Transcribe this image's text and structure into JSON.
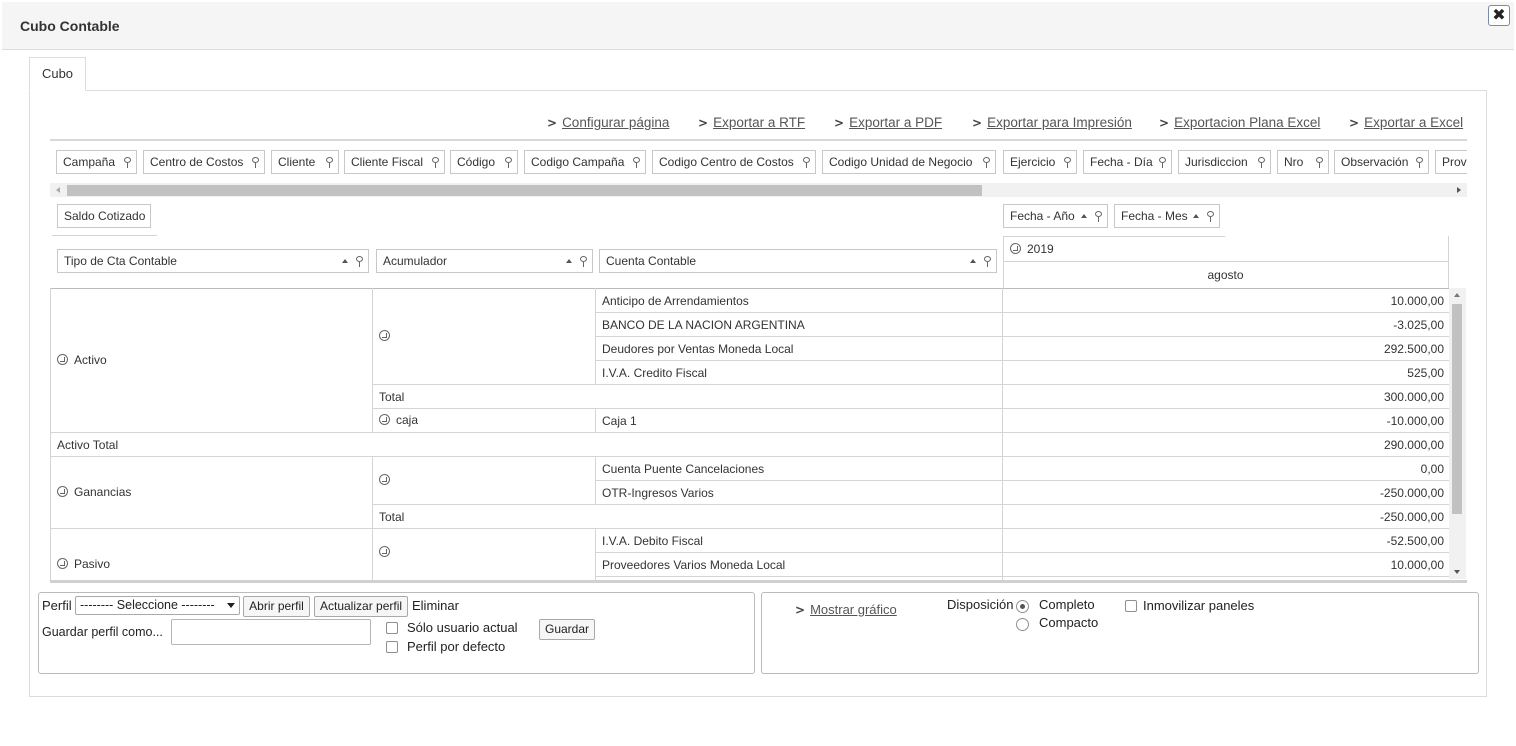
{
  "window": {
    "title": "Cubo Contable",
    "close_glyph": "✖"
  },
  "tabs": [
    {
      "label": "Cubo"
    }
  ],
  "actions": [
    {
      "label": "Configurar página"
    },
    {
      "label": "Exportar a RTF"
    },
    {
      "label": "Exportar a PDF"
    },
    {
      "label": "Exportar para Impresión"
    },
    {
      "label": "Exportacion Plana Excel"
    },
    {
      "label": "Exportar a Excel"
    }
  ],
  "filter_fields": [
    "Campaña",
    "Centro de Costos",
    "Cliente",
    "Cliente Fiscal",
    "Código",
    "Codigo Campaña",
    "Codigo Centro de Costos",
    "Codigo Unidad de Negocio",
    "Ejercicio",
    "Fecha - Día",
    "Jurisdiccion",
    "Nro",
    "Observación",
    "Prov"
  ],
  "data_field": "Saldo Cotizado",
  "column_fields": [
    "Fecha - Año",
    "Fecha - Mes"
  ],
  "row_fields": [
    "Tipo de Cta Contable",
    "Acumulador",
    "Cuenta Contable"
  ],
  "column_headers": {
    "year": "2019",
    "month": "agosto"
  },
  "rows": {
    "activo": {
      "label": "Activo",
      "items": [
        {
          "cuenta": "Anticipo de Arrendamientos",
          "value": "10.000,00"
        },
        {
          "cuenta": "BANCO DE LA NACION ARGENTINA",
          "value": "-3.025,00"
        },
        {
          "cuenta": "Deudores por Ventas Moneda Local",
          "value": "292.500,00"
        },
        {
          "cuenta": "I.V.A. Credito Fiscal",
          "value": "525,00"
        }
      ],
      "subtotal_label": "Total",
      "subtotal_value": "300.000,00",
      "caja": {
        "acumulador": "caja",
        "cuenta": "Caja 1",
        "value": "-10.000,00"
      },
      "total_label": "Activo Total",
      "total_value": "290.000,00"
    },
    "ganancias": {
      "label": "Ganancias",
      "items": [
        {
          "cuenta": "Cuenta Puente Cancelaciones",
          "value": "0,00"
        },
        {
          "cuenta": "OTR-Ingresos Varios",
          "value": "-250.000,00"
        }
      ],
      "subtotal_label": "Total",
      "subtotal_value": "-250.000,00"
    },
    "pasivo": {
      "label": "Pasivo",
      "items": [
        {
          "cuenta": "I.V.A. Debito Fiscal",
          "value": "-52.500,00"
        },
        {
          "cuenta": "Proveedores Varios Moneda Local",
          "value": "10.000,00"
        }
      ]
    }
  },
  "profile": {
    "label": "Perfil",
    "select_value": "-------- Seleccione --------",
    "open_button": "Abrir perfil",
    "update_button": "Actualizar perfil",
    "delete_label": "Eliminar",
    "save_as_label": "Guardar perfil como...",
    "save_as_value": "",
    "only_current_user": "Sólo usuario actual",
    "default_profile": "Perfil por defecto",
    "save_button": "Guardar"
  },
  "options": {
    "show_chart": "Mostrar gráfico",
    "layout_label": "Disposición",
    "layout_complete": "Completo",
    "layout_compact": "Compacto",
    "freeze_panes": "Inmovilizar paneles"
  }
}
